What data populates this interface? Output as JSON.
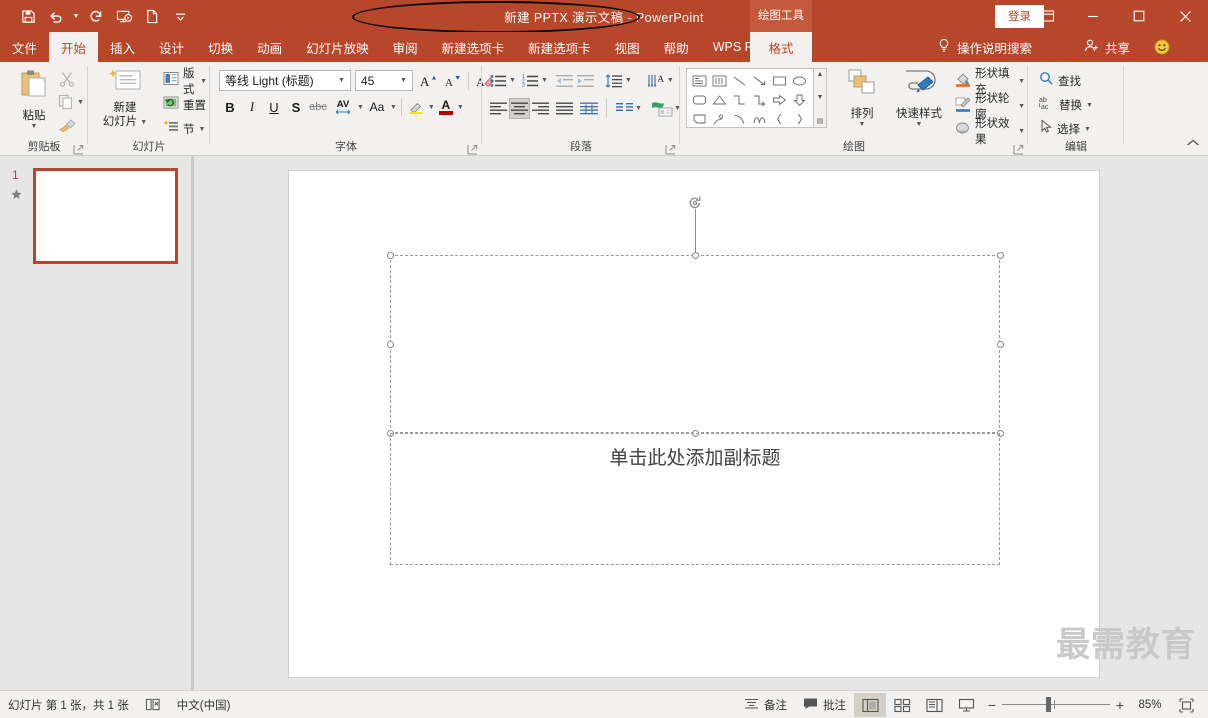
{
  "window": {
    "title": "新建 PPTX 演示文稿  -  PowerPoint",
    "signin_label": "登录",
    "accent_color": "#b7472a",
    "contextual_tab_group": "绘图工具",
    "restore_ribbon_icon": "ribbon-display-options-icon",
    "minimize_icon": "minimize-icon",
    "maximize_icon": "maximize-icon",
    "close_icon": "close-icon"
  },
  "quick_access": [
    {
      "name": "save-icon",
      "label": "保存"
    },
    {
      "name": "undo-icon",
      "label": "撤消"
    },
    {
      "name": "redo-icon",
      "label": "恢复"
    },
    {
      "name": "start-slideshow-icon",
      "label": "从头开始"
    },
    {
      "name": "new-file-icon",
      "label": "新建"
    },
    {
      "name": "customize-qat-icon",
      "label": "自定义快速访问工具栏"
    }
  ],
  "tabs": [
    {
      "label": "文件",
      "active": false
    },
    {
      "label": "开始",
      "active": true
    },
    {
      "label": "插入",
      "active": false
    },
    {
      "label": "设计",
      "active": false
    },
    {
      "label": "切换",
      "active": false
    },
    {
      "label": "动画",
      "active": false
    },
    {
      "label": "幻灯片放映",
      "active": false
    },
    {
      "label": "审阅",
      "active": false
    },
    {
      "label": "新建选项卡",
      "active": false
    },
    {
      "label": "新建选项卡",
      "active": false
    },
    {
      "label": "视图",
      "active": false
    },
    {
      "label": "帮助",
      "active": false
    },
    {
      "label": "WPS PDF",
      "active": false
    }
  ],
  "contextual_tab": {
    "label": "格式",
    "active": true
  },
  "tellme": {
    "label": "操作说明搜索",
    "icon": "lightbulb-icon"
  },
  "share": {
    "label": "共享",
    "icon": "share-person-icon"
  },
  "ribbon": {
    "collapse_label": "折叠功能区",
    "groups": [
      {
        "id": "clipboard",
        "label": "剪贴板",
        "paste_label": "粘贴",
        "cut_label": "剪切",
        "copy_label": "复制",
        "format_painter_label": "格式刷",
        "has_launcher": true
      },
      {
        "id": "slides",
        "label": "幻灯片",
        "new_slide_label": "新建\n幻灯片",
        "new_slide_line1": "新建",
        "new_slide_line2": "幻灯片",
        "layout_label": "版式",
        "reset_label": "重置",
        "section_label": "节",
        "has_launcher": false
      },
      {
        "id": "font",
        "label": "字体",
        "font_name": "等线 Light (标题)",
        "font_size": "45",
        "grow_font_label": "增大字号",
        "shrink_font_label": "减小字号",
        "clear_format_label": "清除所有格式",
        "bold_label": "B",
        "italic_label": "I",
        "underline_label": "U",
        "shadow_label": "S",
        "strike_label": "abc",
        "spacing_label": "AV",
        "case_label": "Aa",
        "highlight_label": "文本突出显示颜色",
        "fontcolor_label": "A",
        "has_launcher": true
      },
      {
        "id": "paragraph",
        "label": "段落",
        "bullets_label": "项目符号",
        "numbering_label": "编号",
        "dec_indent_label": "减少缩进量",
        "inc_indent_label": "增加缩进量",
        "linespacing_label": "行距",
        "text_direction_label": "文字方向",
        "align_text_label": "对齐文本",
        "align_left_label": "左对齐",
        "align_center_label": "居中",
        "align_right_label": "右对齐",
        "justify_label": "两端对齐",
        "columns_label": "分栏",
        "smartart_label": "转换为 SmartArt",
        "has_launcher": true
      },
      {
        "id": "drawing",
        "label": "绘图",
        "arrange_label": "排列",
        "quickstyles_label": "快速样式",
        "shape_fill_label": "形状填充",
        "shape_outline_label": "形状轮廓",
        "shape_effects_label": "形状效果",
        "has_launcher": true,
        "shapes": [
          "textbox-shape",
          "vertical-textbox-shape",
          "line-shape",
          "arrow-shape",
          "rectangle-shape",
          "oval-shape",
          "rounded-rectangle-shape",
          "triangle-shape",
          "elbow-connector-shape",
          "elbow-arrow-shape",
          "right-arrow-shape",
          "down-arrow-shape",
          "folded-corner-shape",
          "scribble-shape",
          "arc-shape",
          "curve-shape",
          "left-brace-shape",
          "right-brace-shape"
        ]
      },
      {
        "id": "editing",
        "label": "编辑",
        "find_label": "查找",
        "replace_label": "替换",
        "select_label": "选择",
        "has_launcher": false
      }
    ]
  },
  "thumbnails": {
    "slides": [
      {
        "number": "1",
        "has_animation": true
      }
    ]
  },
  "slide": {
    "title_placeholder_text": "",
    "subtitle_placeholder_text": "单击此处添加副标题"
  },
  "watermark": {
    "text": "最需教育"
  },
  "statusbar": {
    "slide_count_text": "幻灯片 第 1 张，共 1 张",
    "accessibility_icon": "accessibility-check-icon",
    "language": "中文(中国)",
    "notes_label": "备注",
    "comments_label": "批注",
    "views": [
      {
        "name": "normal-view",
        "label": "普通视图",
        "active": true
      },
      {
        "name": "slide-sorter-view",
        "label": "幻灯片浏览",
        "active": false
      },
      {
        "name": "reading-view",
        "label": "阅读视图",
        "active": false
      },
      {
        "name": "slideshow-view",
        "label": "幻灯片放映",
        "active": false
      }
    ],
    "zoom_out_label": "−",
    "zoom_in_label": "+",
    "zoom_level": "85%",
    "fit_label": "使幻灯片适应当前窗口"
  }
}
